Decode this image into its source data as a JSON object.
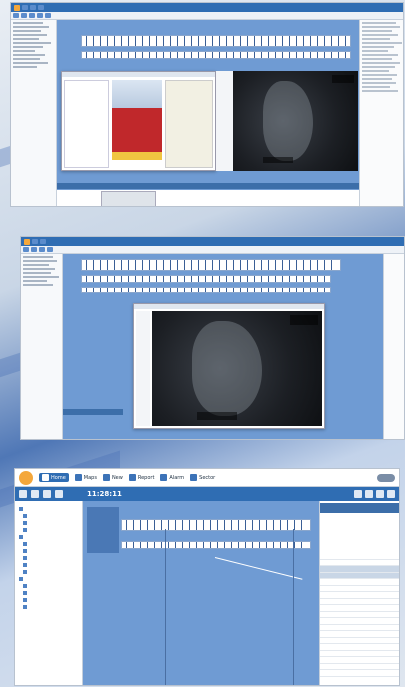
{
  "screens": [
    {
      "title": "",
      "has_map": true,
      "has_table": true
    },
    {
      "title": "",
      "has_map": true,
      "has_dialog": true
    },
    {
      "title": "",
      "clock": "11:28:11"
    }
  ],
  "toolbar3": {
    "home_label": "Home",
    "items": [
      "Maps",
      "New",
      "Report",
      "Alarm",
      "Sector"
    ]
  },
  "colors": {
    "accent": "#2f6db3",
    "work": "#6f9bd3",
    "logo": "#f4a73b",
    "alert": "#c0282b",
    "warn": "#f0c541"
  },
  "icons": [
    "home-icon",
    "map-icon",
    "new-icon",
    "report-icon",
    "alarm-icon",
    "sector-icon",
    "toggle-icon"
  ]
}
